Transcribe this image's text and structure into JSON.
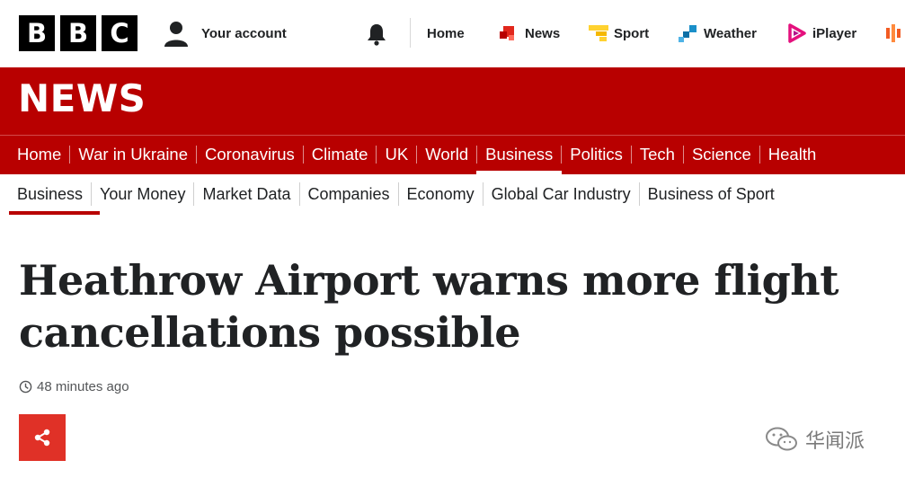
{
  "global_bar": {
    "logo_letters": [
      "B",
      "B",
      "C"
    ],
    "account_label": "Your account",
    "links": [
      {
        "label": "Home",
        "icon": "none"
      },
      {
        "label": "News",
        "icon": "news-icon",
        "color": "#e1271c"
      },
      {
        "label": "Sport",
        "icon": "sport-icon",
        "color": "#ffd230"
      },
      {
        "label": "Weather",
        "icon": "weather-icon",
        "color": "#1a8fc9"
      },
      {
        "label": "iPlayer",
        "icon": "iplayer-icon",
        "color": "#e4107d"
      }
    ]
  },
  "banner": {
    "title": "NEWS",
    "color": "#b80000"
  },
  "primary_nav": {
    "items": [
      "Home",
      "War in Ukraine",
      "Coronavirus",
      "Climate",
      "UK",
      "World",
      "Business",
      "Politics",
      "Tech",
      "Science",
      "Health"
    ],
    "active": "Business"
  },
  "secondary_nav": {
    "items": [
      "Business",
      "Your Money",
      "Market Data",
      "Companies",
      "Economy",
      "Global Car Industry",
      "Business of Sport"
    ],
    "active": "Business"
  },
  "article": {
    "headline": "Heathrow Airport warns more flight cancellations possible",
    "timestamp": "48 minutes ago",
    "share_icon": "share-icon",
    "share_color": "#e03127"
  },
  "watermark": {
    "text": "华闻派",
    "icon": "wechat-icon"
  }
}
